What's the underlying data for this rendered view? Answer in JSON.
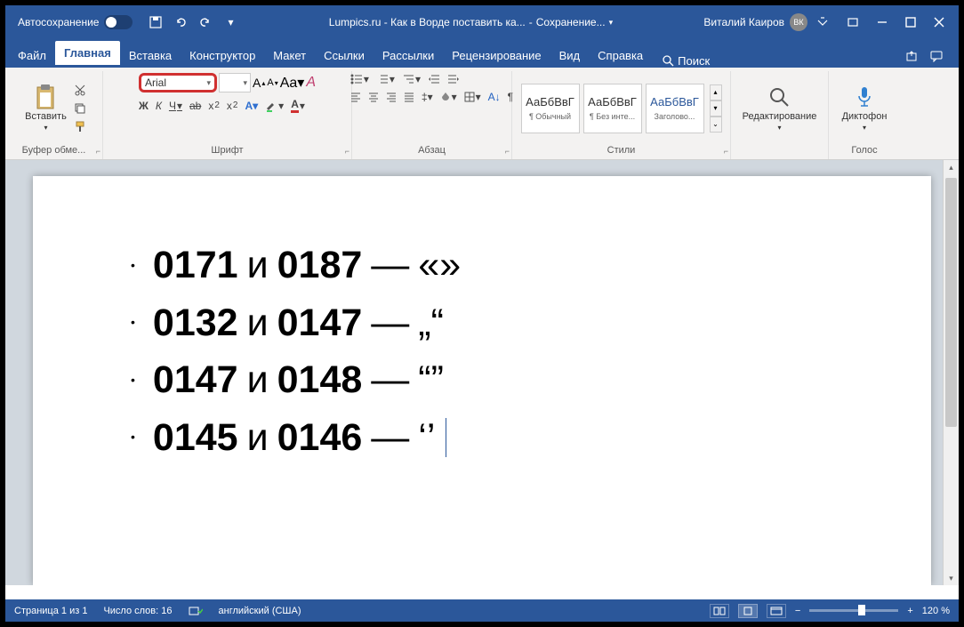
{
  "titlebar": {
    "autosave": "Автосохранение",
    "doc_name": "Lumpics.ru - Как в Ворде поставить ка...",
    "save_status": "Сохранение...",
    "user": "Виталий Каиров",
    "user_initials": "ВК"
  },
  "tabs": {
    "file": "Файл",
    "home": "Главная",
    "insert": "Вставка",
    "design": "Конструктор",
    "layout": "Макет",
    "references": "Ссылки",
    "mailings": "Рассылки",
    "review": "Рецензирование",
    "view": "Вид",
    "help": "Справка",
    "search": "Поиск"
  },
  "ribbon": {
    "clipboard": {
      "paste": "Вставить",
      "label": "Буфер обме..."
    },
    "font": {
      "name": "Arial",
      "size": "",
      "bold": "Ж",
      "italic": "К",
      "underline": "Ч",
      "strike": "ab",
      "label": "Шрифт"
    },
    "paragraph": {
      "label": "Абзац"
    },
    "styles": {
      "label": "Стили",
      "preview": "АаБбВвГ",
      "s1": "¶ Обычный",
      "s2": "¶ Без инте...",
      "s3": "Заголово..."
    },
    "editing": {
      "label": "Редактирование"
    },
    "voice": {
      "btn": "Диктофон",
      "label": "Голос"
    }
  },
  "document": {
    "rows": [
      {
        "c1": "0171",
        "and": "и",
        "c2": "0187",
        "dash": "—",
        "sym": "«»"
      },
      {
        "c1": "0132",
        "and": "и",
        "c2": "0147",
        "dash": "—",
        "sym": "„“"
      },
      {
        "c1": "0147",
        "and": "и",
        "c2": "0148",
        "dash": "—",
        "sym": "“”"
      },
      {
        "c1": "0145",
        "and": "и",
        "c2": "0146",
        "dash": "—",
        "sym": "‘’"
      }
    ]
  },
  "status": {
    "page": "Страница 1 из 1",
    "words": "Число слов: 16",
    "lang": "английский (США)",
    "zoom": "120 %"
  }
}
